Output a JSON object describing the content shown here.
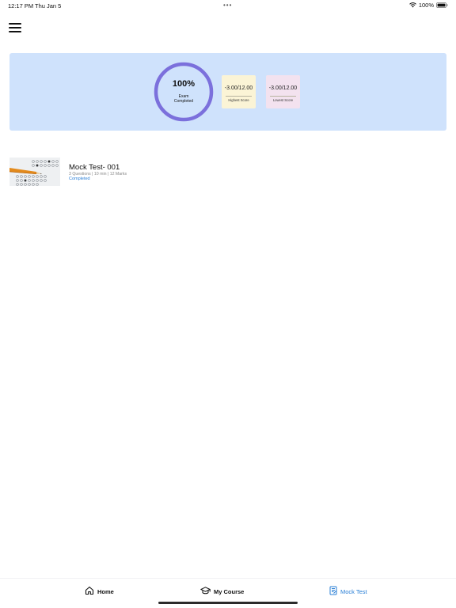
{
  "status_bar": {
    "time": "12:17 PM",
    "date": "Thu Jan 5",
    "dots": "•••",
    "battery": "100%"
  },
  "summary": {
    "progress": {
      "percent_label": "100%",
      "caption": "Exam Completed",
      "value": 100
    },
    "highest": {
      "value": "-3.00/12.00",
      "label": "Highest Score"
    },
    "lowest": {
      "value": "-3.00/12.00",
      "label": "Lowest Score"
    },
    "colors": {
      "card": "#cfe2fc",
      "ring": "#7b70dc",
      "highest_bg": "#fbf4d6",
      "lowest_bg": "#f3e2ef"
    }
  },
  "tests": [
    {
      "title": "Mock Test- 001",
      "meta": "3 Questions | 10 min | 12 Marks",
      "status": "Completed"
    }
  ],
  "nav": {
    "home": "Home",
    "my_course": "My Course",
    "mock_test": "Mock Test",
    "active_color": "#2a7fd6"
  },
  "icons": {
    "menu": "hamburger-icon",
    "home": "house-icon",
    "course": "graduation-cap-icon",
    "mock": "clipboard-icon"
  }
}
